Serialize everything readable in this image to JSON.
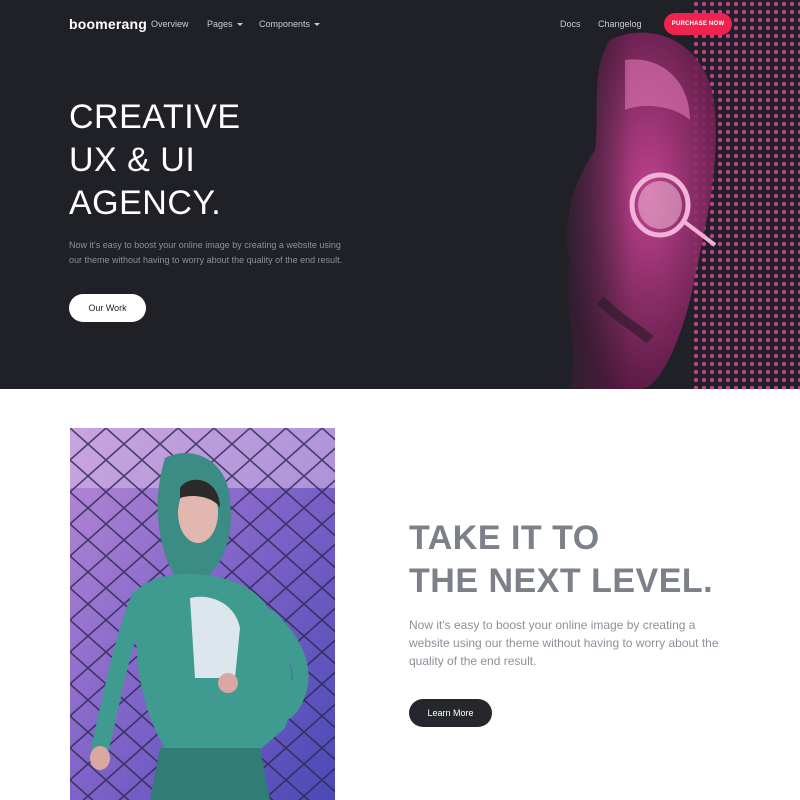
{
  "nav": {
    "brand": "boomerang",
    "links": [
      {
        "label": "Overview",
        "has_caret": false
      },
      {
        "label": "Pages",
        "has_caret": true
      },
      {
        "label": "Components",
        "has_caret": true
      }
    ],
    "right_links": [
      {
        "label": "Docs"
      },
      {
        "label": "Changelog"
      }
    ],
    "purchase_label": "PURCHASE NOW"
  },
  "hero": {
    "title_lines": [
      "CREATIVE",
      "UX & UI",
      "AGENCY."
    ],
    "text": "Now it's easy to boost your online image by creating a website using our theme without having to worry about the quality of the end result.",
    "button_label": "Our Work"
  },
  "section2": {
    "title_lines": [
      "TAKE IT TO",
      "THE NEXT LEVEL."
    ],
    "text": "Now it's easy to boost your online image by creating a website using our theme without having to worry about the quality of the end result.",
    "button_label": "Learn More"
  },
  "colors": {
    "hero_bg": "#1f2127",
    "accent": "#f0224f",
    "muted_text": "#8c9099",
    "dark_button": "#25272c"
  }
}
